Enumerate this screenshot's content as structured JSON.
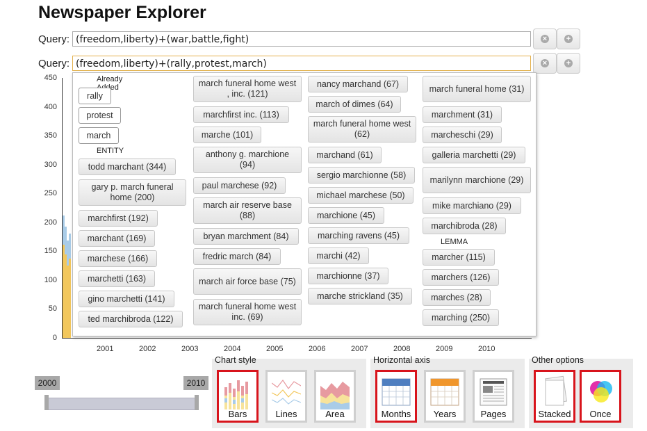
{
  "app": {
    "title": "Newspaper Explorer"
  },
  "queries": [
    {
      "label": "Query:",
      "value": "(freedom,liberty)+(war,battle,fight)"
    },
    {
      "label": "Query:",
      "value": "(freedom,liberty)+(rally,protest,march)"
    }
  ],
  "buttons": {
    "remove_glyph": "×",
    "add_glyph": "+"
  },
  "dropdown": {
    "already_added_label": "Already Added",
    "already_added": [
      "rally",
      "protest",
      "march"
    ],
    "entity_label": "ENTITY",
    "lemma_label": "LEMMA",
    "col1": [
      "todd marchant (344)",
      "gary p. march funeral home (200)",
      "marchfirst (192)",
      "marchant (169)",
      "marchese (166)",
      "marchetti (163)",
      "gino marchetti (141)",
      "ted marchibroda (122)"
    ],
    "col2": [
      "march funeral home west , inc. (121)",
      "marchfirst inc. (113)",
      "marche (101)",
      "anthony g. marchione (94)",
      "paul marchese (92)",
      "march air reserve base (88)",
      "bryan marchment (84)",
      "fredric march (84)",
      "march air force base (75)",
      "march funeral home west inc. (69)"
    ],
    "col3": [
      "nancy marchand (67)",
      "march of dimes (64)",
      "march funeral home west (62)",
      "marchand (61)",
      "sergio marchionne (58)",
      "michael marchese (50)",
      "marchione (45)",
      "marching ravens (45)",
      "marchi (42)",
      "marchionne (37)",
      "marche strickland (35)"
    ],
    "col4": [
      "march funeral home (31)",
      "marchment (31)",
      "marcheschi (29)",
      "galleria marchetti (29)",
      "marilynn marchione (29)",
      "mike marchiano (29)",
      "marchibroda (28)"
    ],
    "lemma": [
      "marcher (115)",
      "marchers (126)",
      "marches (28)",
      "marching (250)"
    ]
  },
  "chart_data": {
    "type": "bar",
    "yticks": [
      "450",
      "400",
      "350",
      "300",
      "250",
      "200",
      "150",
      "100",
      "50",
      "0"
    ],
    "xticks": [
      "2001",
      "2002",
      "2003",
      "2004",
      "2005",
      "2006",
      "2007",
      "2008",
      "2009",
      "2010"
    ],
    "ylim": [
      0,
      450
    ],
    "colors": {
      "series_a": "#f2c75c",
      "series_b": "#a9cce8"
    }
  },
  "time_range": {
    "start": "2000",
    "end": "2010"
  },
  "options": {
    "chart_style": {
      "title": "Chart style",
      "items": [
        "Bars",
        "Lines",
        "Area"
      ],
      "selected": "Bars"
    },
    "horizontal_axis": {
      "title": "Horizontal axis",
      "items": [
        "Months",
        "Years",
        "Pages"
      ],
      "selected": "Months"
    },
    "other": {
      "title": "Other options",
      "items": [
        "Stacked",
        "Once"
      ],
      "selected": [
        "Stacked",
        "Once"
      ]
    }
  },
  "colors": {
    "selected_border": "#d8141c",
    "active_input_border": "#e3b04b"
  }
}
